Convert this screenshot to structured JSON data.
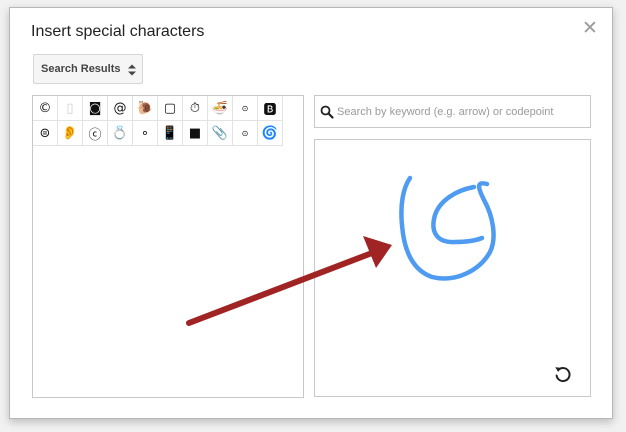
{
  "dialog": {
    "title": "Insert special characters",
    "close_glyph": "✕"
  },
  "category_select": {
    "value": "Search Results"
  },
  "search": {
    "placeholder": "Search by keyword (e.g. arrow) or codepoint",
    "value": ""
  },
  "characters": [
    {
      "glyph": "©",
      "name": "copyright-sign"
    },
    {
      "glyph": "▯",
      "name": "placeholder-glyph",
      "style": "faint"
    },
    {
      "glyph": "◙",
      "name": "inverse-white-circle"
    },
    {
      "glyph": "@",
      "name": "at-sign"
    },
    {
      "glyph": "🐌",
      "name": "spiral-shell"
    },
    {
      "glyph": "▢",
      "name": "square-rounded"
    },
    {
      "glyph": "⏱",
      "name": "stopwatch"
    },
    {
      "glyph": "🍜",
      "name": "bowl"
    },
    {
      "glyph": "⊙",
      "name": "circled-dot",
      "style": "small"
    },
    {
      "glyph": "🅱",
      "name": "negative-squared-b"
    },
    {
      "glyph": "⊜",
      "name": "circled-equals"
    },
    {
      "glyph": "👂",
      "name": "ear"
    },
    {
      "glyph": "ⓒ",
      "name": "circled-c"
    },
    {
      "glyph": "💍",
      "name": "ring"
    },
    {
      "glyph": "∘",
      "name": "ring-operator"
    },
    {
      "glyph": "📱",
      "name": "mobile-phone"
    },
    {
      "glyph": "■",
      "name": "black-square"
    },
    {
      "glyph": "📎",
      "name": "paperclip"
    },
    {
      "glyph": "⊙",
      "name": "circled-dot-operator",
      "style": "small"
    },
    {
      "glyph": "🌀",
      "name": "cyclone"
    }
  ],
  "colors": {
    "drawing_stroke": "#4f9bf2",
    "annotation_arrow": "#a12424"
  },
  "icons": {
    "close": "close-icon",
    "select_arrows": "up-down-arrows-icon",
    "search": "search-icon",
    "undo": "undo-icon"
  }
}
